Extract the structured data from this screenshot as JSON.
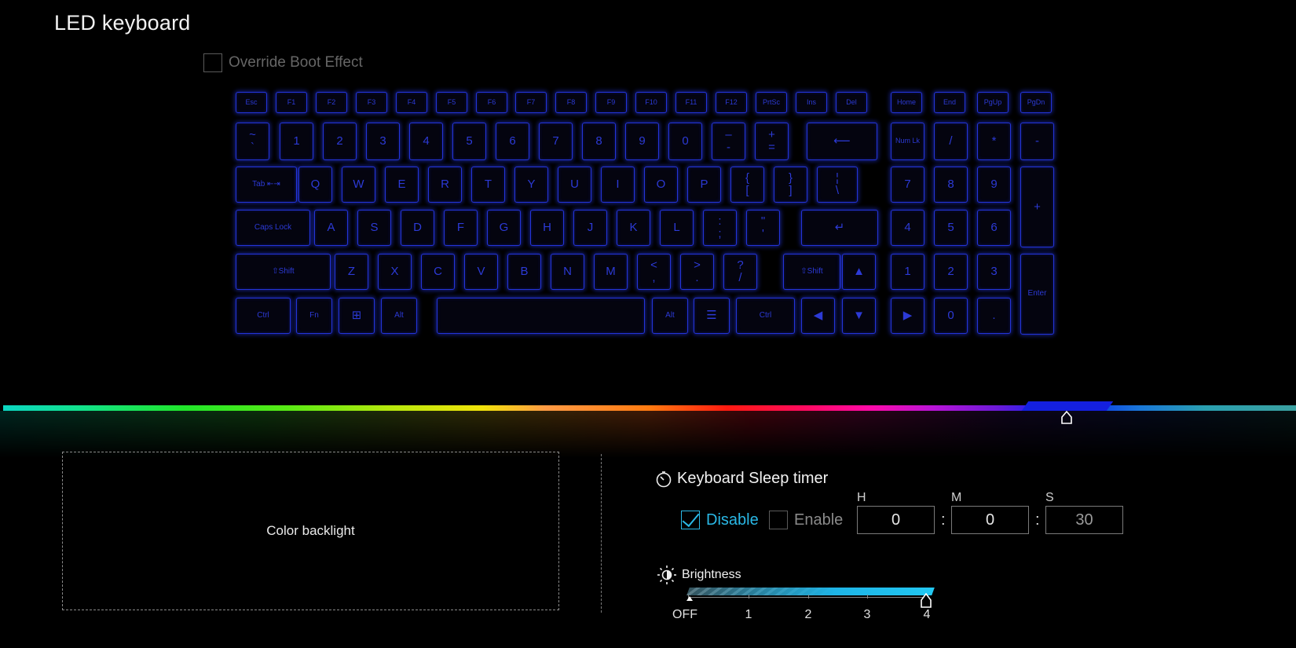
{
  "title": "LED keyboard",
  "override_boot_effect": {
    "label": "Override Boot Effect",
    "checked": false
  },
  "keyboard_rows": {
    "fn": [
      "Esc",
      "F1",
      "F2",
      "F3",
      "F4",
      "F5",
      "F6",
      "F7",
      "F8",
      "F9",
      "F10",
      "F11",
      "F12",
      "PrtSc",
      "Ins",
      "Del",
      "Home",
      "End",
      "PgUp",
      "PgDn"
    ],
    "num": [
      "~\n`",
      "1",
      "2",
      "3",
      "4",
      "5",
      "6",
      "7",
      "8",
      "9",
      "0",
      "–\n-",
      "+\n=",
      "⟵",
      "Num Lk",
      "/",
      "*",
      "-"
    ],
    "top": [
      "Tab ⇤⇥",
      "Q",
      "W",
      "E",
      "R",
      "T",
      "Y",
      "U",
      "I",
      "O",
      "P",
      "{\n[",
      "}\n]",
      "¦\n\\",
      "7",
      "8",
      "9",
      "+"
    ],
    "home": [
      "Caps Lock",
      "A",
      "S",
      "D",
      "F",
      "G",
      "H",
      "J",
      "K",
      "L",
      ":\n;",
      "\"\n'",
      "↵",
      "4",
      "5",
      "6"
    ],
    "shift": [
      "⇧Shift",
      "Z",
      "X",
      "C",
      "V",
      "B",
      "N",
      "M",
      "<\n,",
      ">\n.",
      "?\n/",
      "⇧Shift",
      "▲",
      "1",
      "2",
      "3",
      "Enter"
    ],
    "bottom": [
      "Ctrl",
      "Fn",
      "⊞",
      "Alt",
      "",
      "Alt",
      "☰",
      "Ctrl",
      "◀",
      "▼",
      "▶",
      "0",
      "."
    ]
  },
  "color_bar": {
    "selected_color": "#1420e0"
  },
  "color_backlight": {
    "label": "Color backlight"
  },
  "sleep_timer": {
    "title": "Keyboard Sleep timer",
    "disable_label": "Disable",
    "enable_label": "Enable",
    "selected": "Disable",
    "h_label": "H",
    "m_label": "M",
    "s_label": "S",
    "h": "0",
    "m": "0",
    "s": "30",
    "colon": ":"
  },
  "brightness": {
    "title": "Brightness",
    "levels": [
      "OFF",
      "1",
      "2",
      "3",
      "4"
    ],
    "value": 4,
    "accent": "#1eb4e6"
  }
}
